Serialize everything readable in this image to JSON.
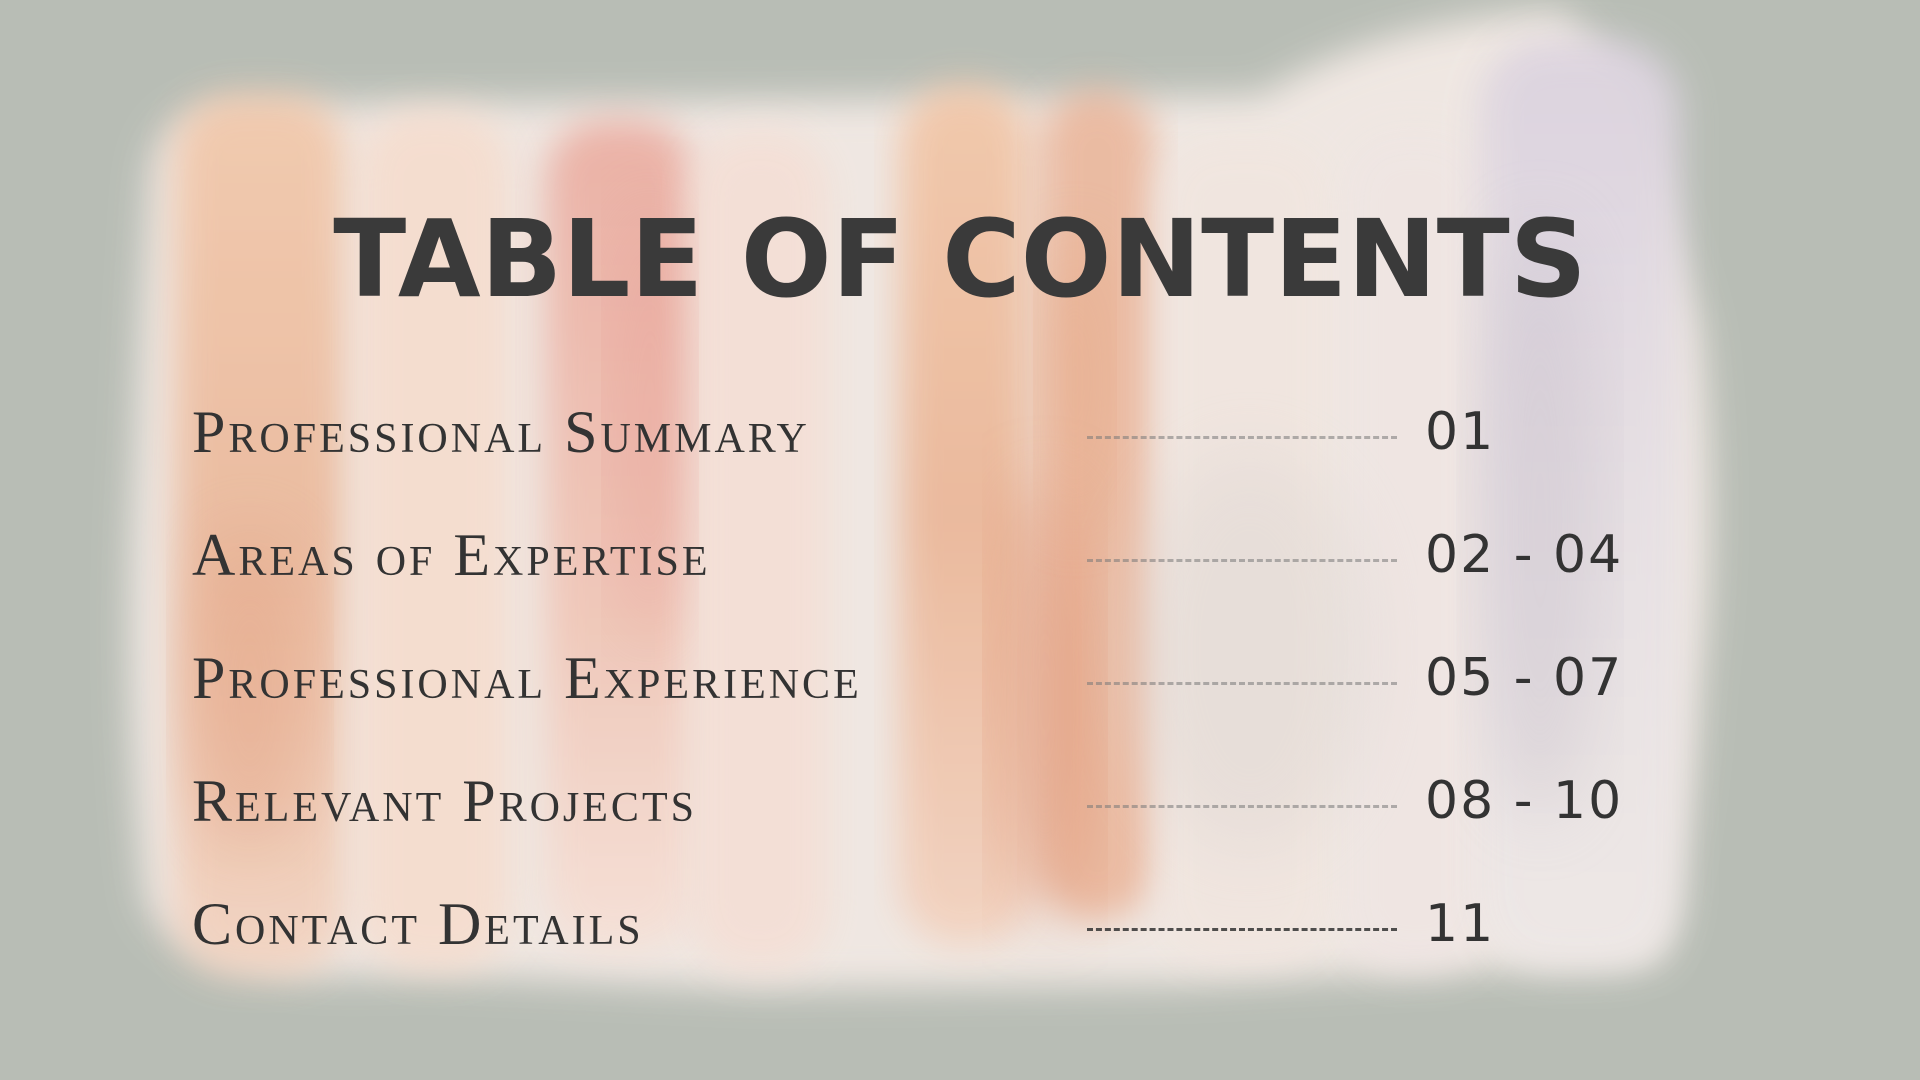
{
  "slide": {
    "title": "TABLE OF CONTENTS",
    "background_color": "#b8bdb5",
    "text_color": "#333333",
    "entries": [
      {
        "label": "Professional Summary",
        "pages": "01"
      },
      {
        "label": "Areas of Expertise",
        "pages": "02 - 04"
      },
      {
        "label": "Professional Experience",
        "pages": "05 - 07"
      },
      {
        "label": "Relevant Projects",
        "pages": "08 - 10"
      },
      {
        "label": "Contact Details",
        "pages": "11"
      }
    ]
  }
}
